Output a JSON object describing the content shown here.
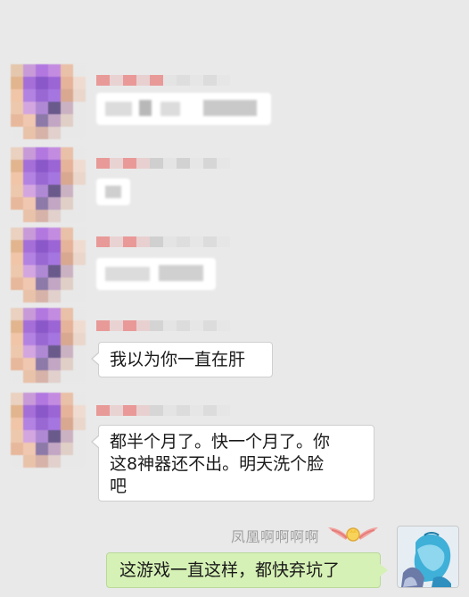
{
  "colors": {
    "background": "#e9e9e9",
    "incoming_bubble": "#ffffff",
    "outgoing_bubble": "#d5f1b5",
    "name_text": "#a0a0a0"
  },
  "messages": [
    {
      "sender": "other",
      "redacted": true
    },
    {
      "sender": "other",
      "redacted": true
    },
    {
      "sender": "other",
      "redacted": true
    },
    {
      "sender": "other",
      "text": "我以为你一直在肝"
    },
    {
      "sender": "other",
      "lines": [
        "都半个月了。快一个月了。你",
        "这8神器还不出。明天洗个脸",
        "吧"
      ]
    },
    {
      "sender": "me",
      "name": "凤凰啊啊啊啊",
      "text": "这游戏一直这样，都快弃坑了"
    }
  ],
  "icons": {
    "avatar": "avatar-icon",
    "badge": "wings-badge-icon"
  }
}
